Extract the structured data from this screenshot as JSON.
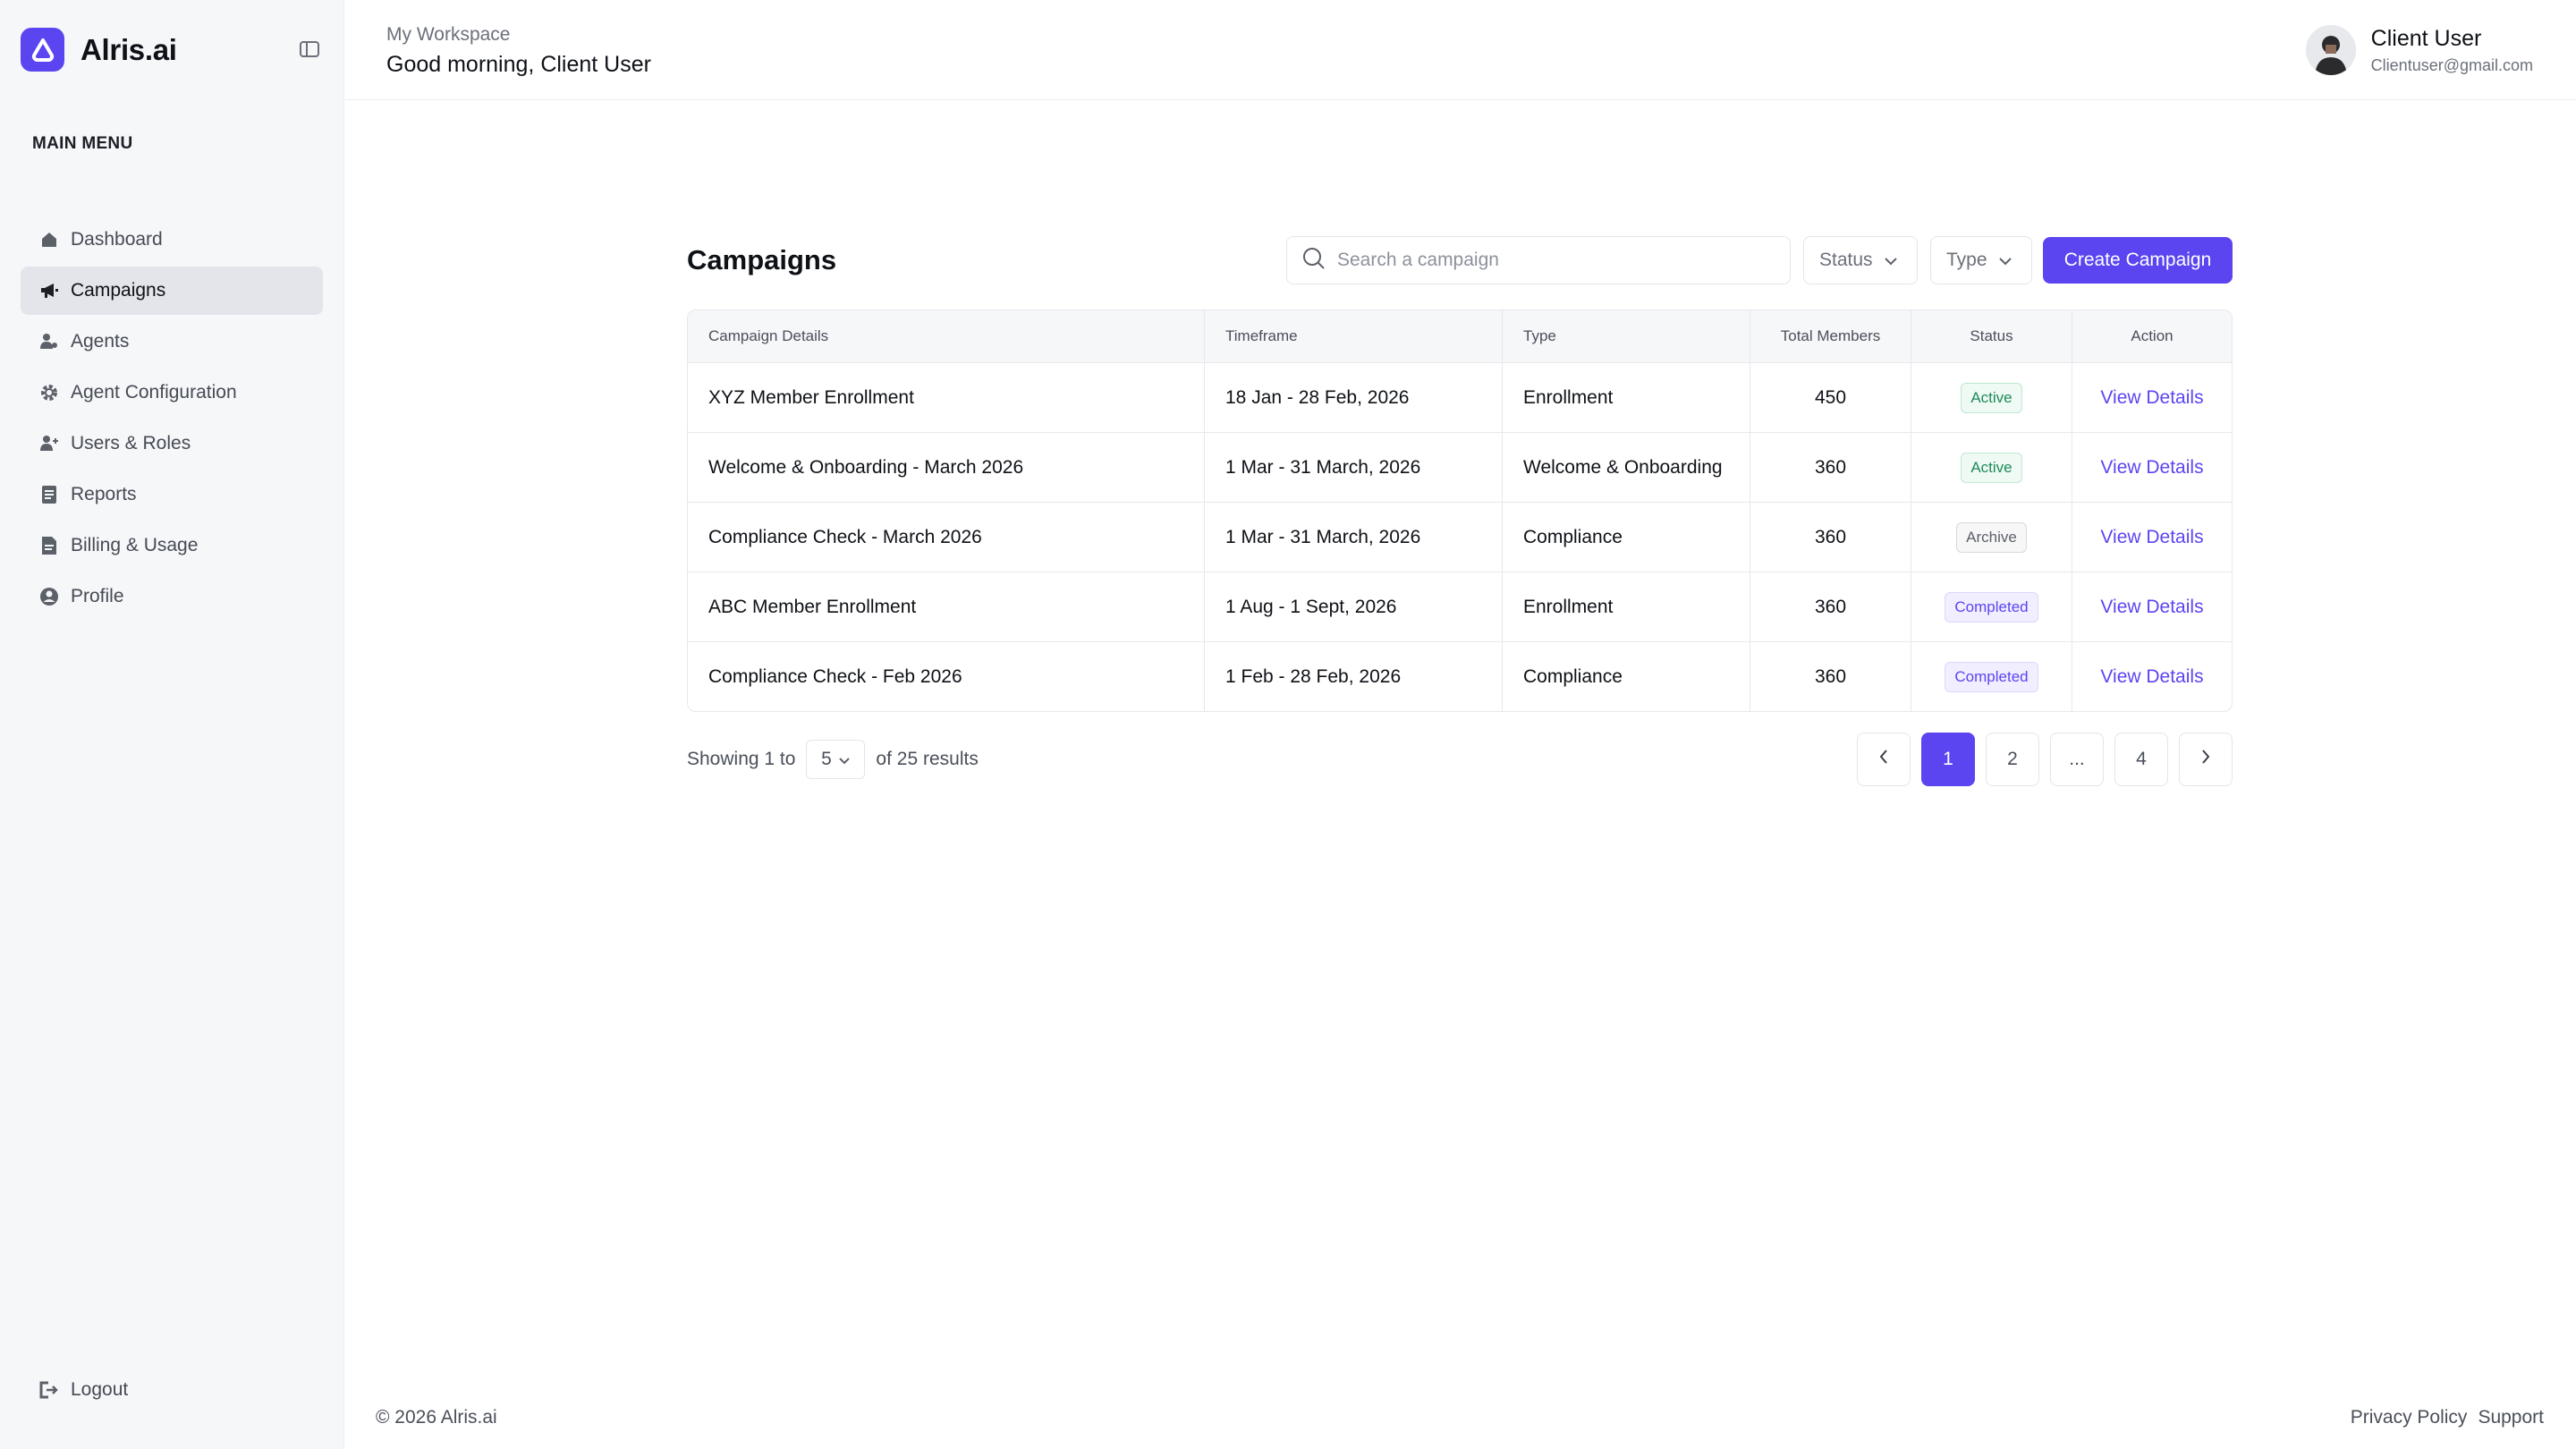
{
  "brand": {
    "name": "Alris.ai"
  },
  "sidebar": {
    "heading": "MAIN MENU",
    "items": [
      {
        "label": "Dashboard",
        "icon": "home-icon"
      },
      {
        "label": "Campaigns",
        "icon": "megaphone-icon",
        "active": true
      },
      {
        "label": "Agents",
        "icon": "agents-icon"
      },
      {
        "label": "Agent Configuration",
        "icon": "gear-icon"
      },
      {
        "label": "Users & Roles",
        "icon": "user-plus-icon"
      },
      {
        "label": "Reports",
        "icon": "document-icon"
      },
      {
        "label": "Billing & Usage",
        "icon": "billing-icon"
      },
      {
        "label": "Profile",
        "icon": "profile-icon"
      }
    ],
    "logout": "Logout"
  },
  "header": {
    "workspace": "My Workspace",
    "greeting": "Good morning, Client User",
    "user_name": "Client User",
    "user_email": "Clientuser@gmail.com"
  },
  "main": {
    "title": "Campaigns",
    "search_placeholder": "Search a campaign",
    "filter_status": "Status",
    "filter_type": "Type",
    "create_button": "Create Campaign"
  },
  "table": {
    "columns": [
      "Campaign Details",
      "Timeframe",
      "Type",
      "Total Members",
      "Status",
      "Action"
    ],
    "rows": [
      {
        "name": "XYZ Member Enrollment",
        "timeframe": "18 Jan - 28 Feb, 2026",
        "type": "Enrollment",
        "members": "450",
        "status": "Active",
        "status_kind": "active",
        "action": "View Details"
      },
      {
        "name": "Welcome & Onboarding - March 2026",
        "timeframe": "1 Mar -  31 March, 2026",
        "type": "Welcome & Onboarding",
        "members": "360",
        "status": "Active",
        "status_kind": "active",
        "action": "View Details"
      },
      {
        "name": "Compliance Check - March 2026",
        "timeframe": "1 Mar -  31 March, 2026",
        "type": "Compliance",
        "members": "360",
        "status": "Archive",
        "status_kind": "archive",
        "action": "View Details"
      },
      {
        "name": "ABC Member Enrollment",
        "timeframe": "1 Aug - 1 Sept, 2026",
        "type": "Enrollment",
        "members": "360",
        "status": "Completed",
        "status_kind": "completed",
        "action": "View Details"
      },
      {
        "name": "Compliance Check - Feb 2026",
        "timeframe": "1 Feb -  28 Feb, 2026",
        "type": "Compliance",
        "members": "360",
        "status": "Completed",
        "status_kind": "completed",
        "action": "View Details"
      }
    ]
  },
  "pagination": {
    "showing_prefix": "Showing 1 to",
    "per_page": "5",
    "showing_suffix": "of 25 results",
    "pages": [
      "1",
      "2",
      "...",
      "4"
    ],
    "current": "1"
  },
  "footer": {
    "copyright": "© 2026 Alris.ai",
    "links": [
      "Privacy Policy",
      "Support"
    ]
  },
  "colors": {
    "accent": "#5b45f0",
    "active_status": "#1f8a5a"
  }
}
